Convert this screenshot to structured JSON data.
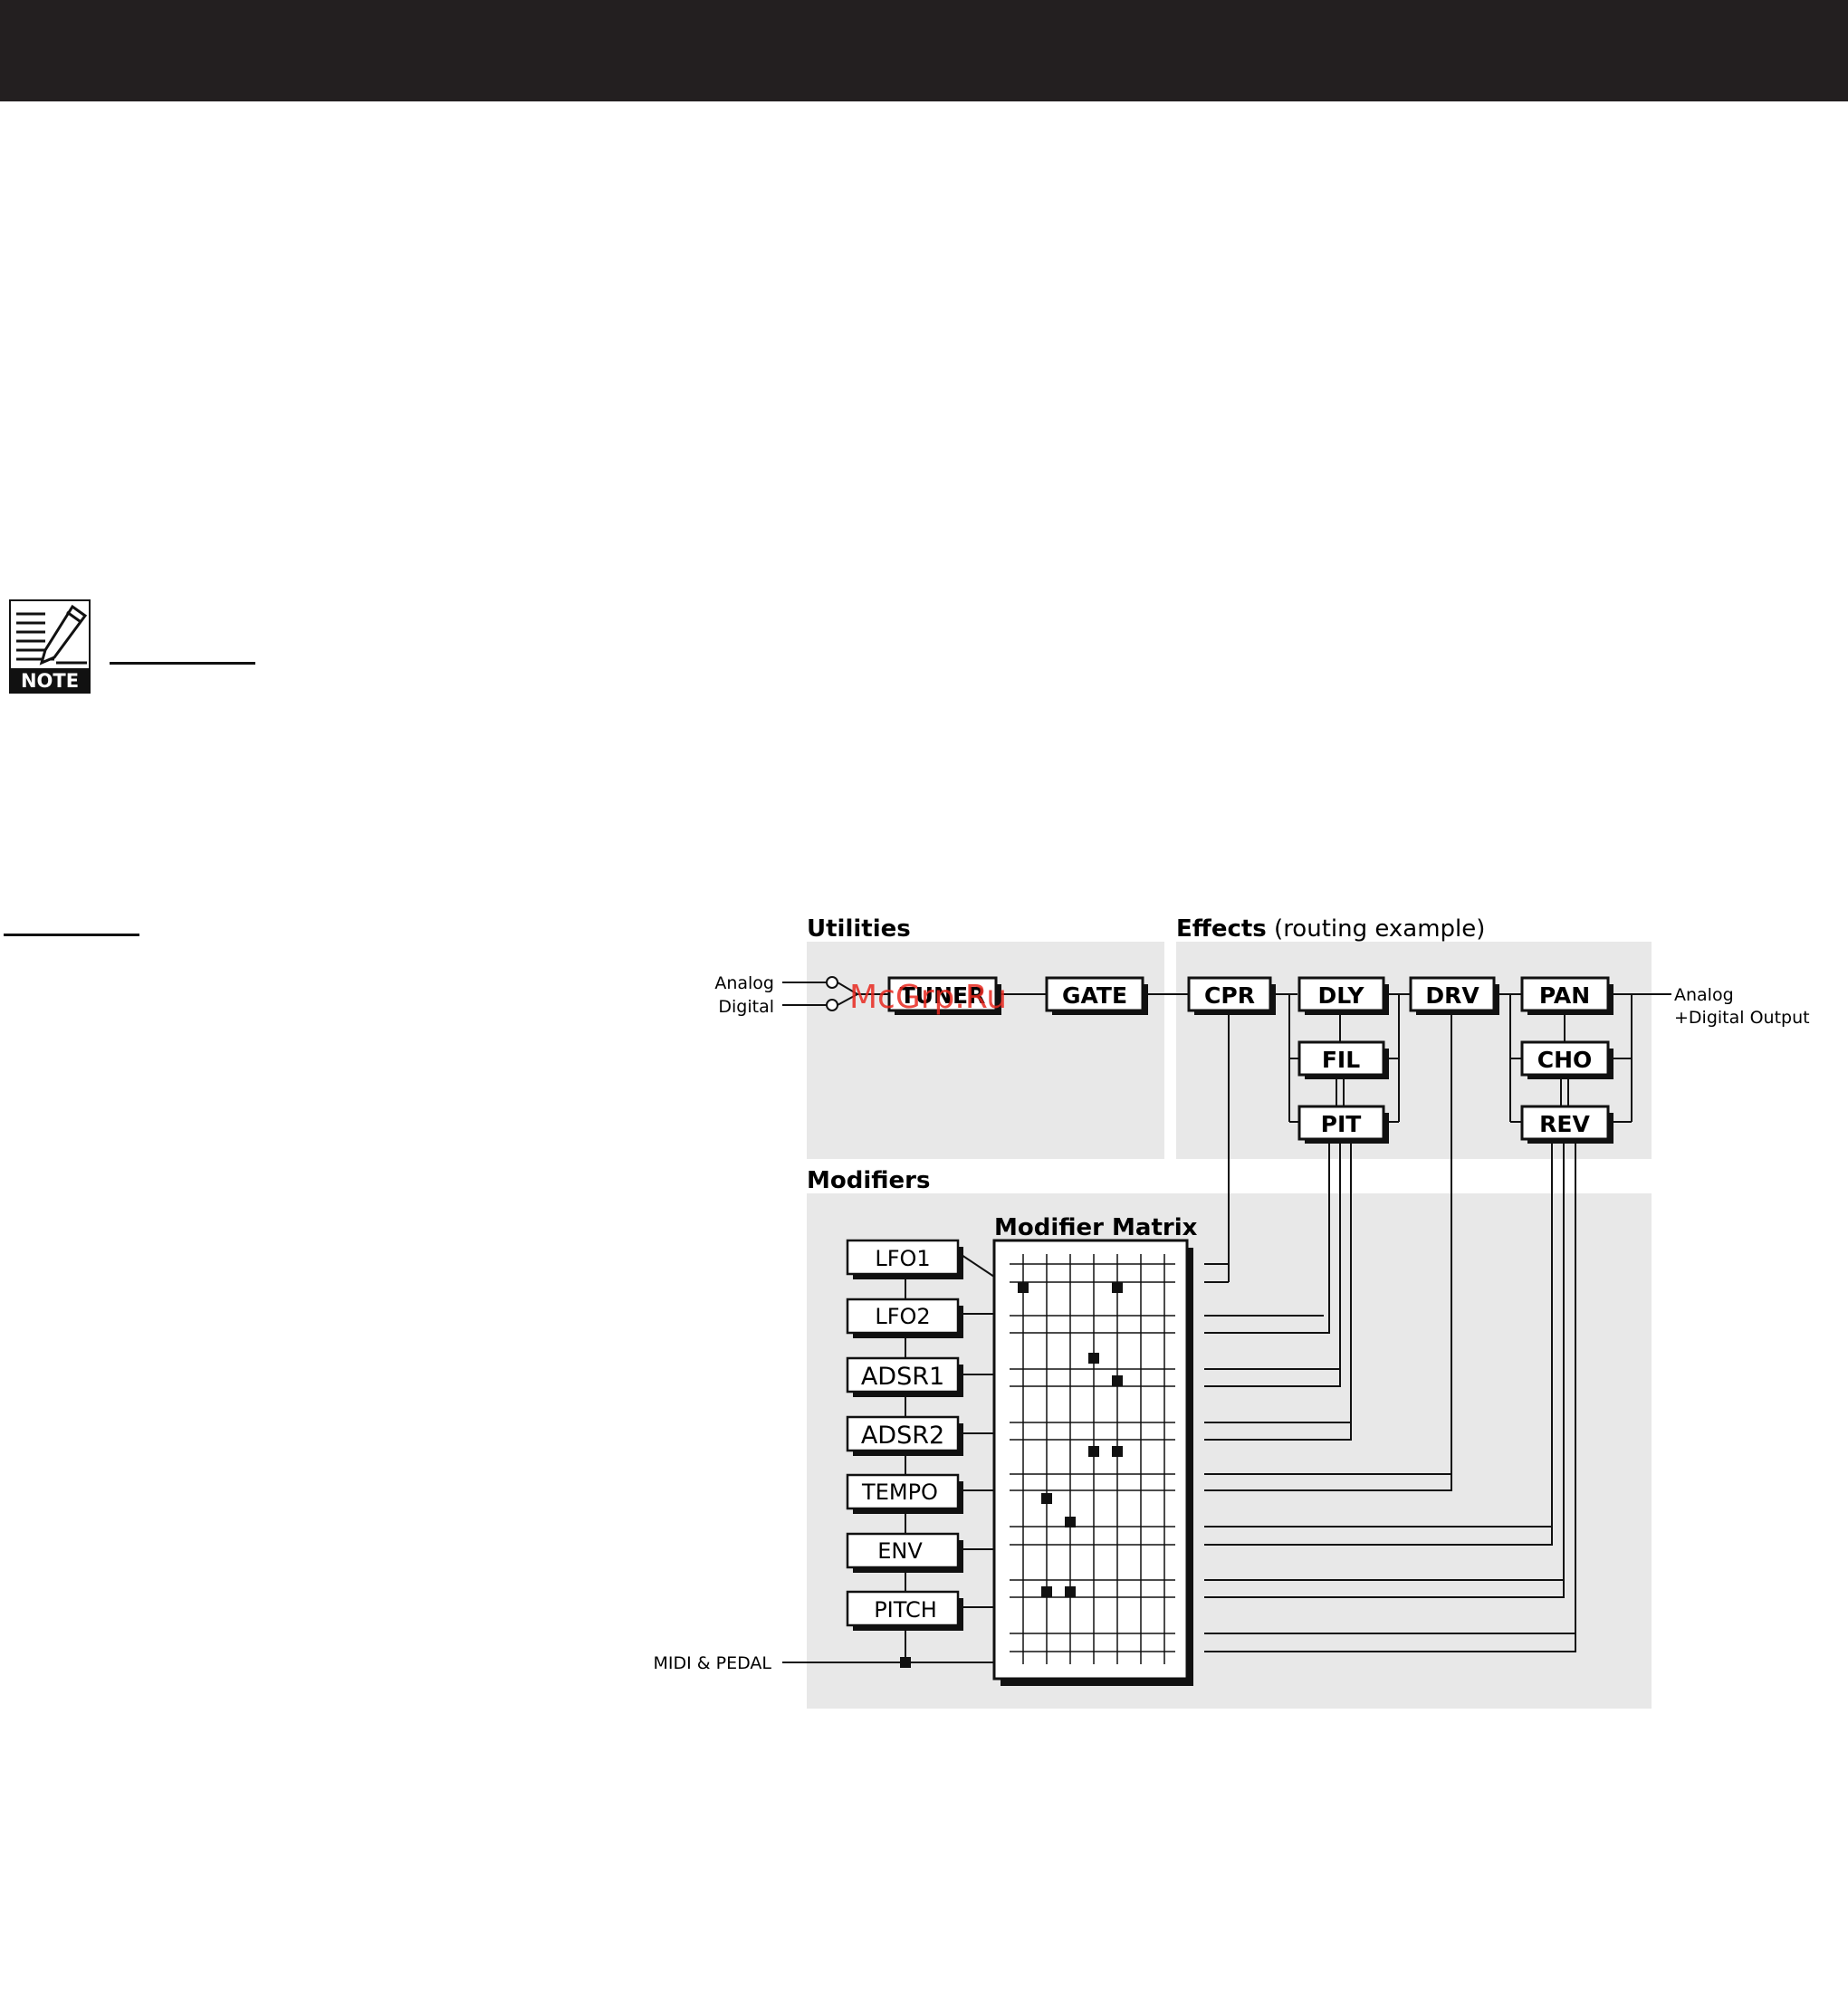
{
  "note_icon": {
    "label": "NOTE",
    "icon": "note-pencil-icon"
  },
  "watermark": "McGrp.Ru",
  "diagram": {
    "sections": {
      "utilities": "Utilities",
      "effects_bold": "Effects",
      "effects_rest": " (routing example)",
      "modifiers": "Modifiers",
      "matrix": "Modifier Matrix"
    },
    "inputs": {
      "analog": "Analog",
      "digital": "Digital"
    },
    "output": {
      "line1": "Analog",
      "line2": "+Digital Output"
    },
    "midi": "MIDI & PEDAL",
    "utility_blocks": [
      "TUNER",
      "GATE"
    ],
    "effect_blocks": [
      "CPR",
      "DLY",
      "FIL",
      "PIT",
      "DRV",
      "PAN",
      "CHO",
      "REV"
    ],
    "modifier_blocks": [
      "LFO1",
      "LFO2",
      "ADSR1",
      "ADSR2",
      "TEMPO",
      "ENV",
      "PITCH"
    ]
  }
}
